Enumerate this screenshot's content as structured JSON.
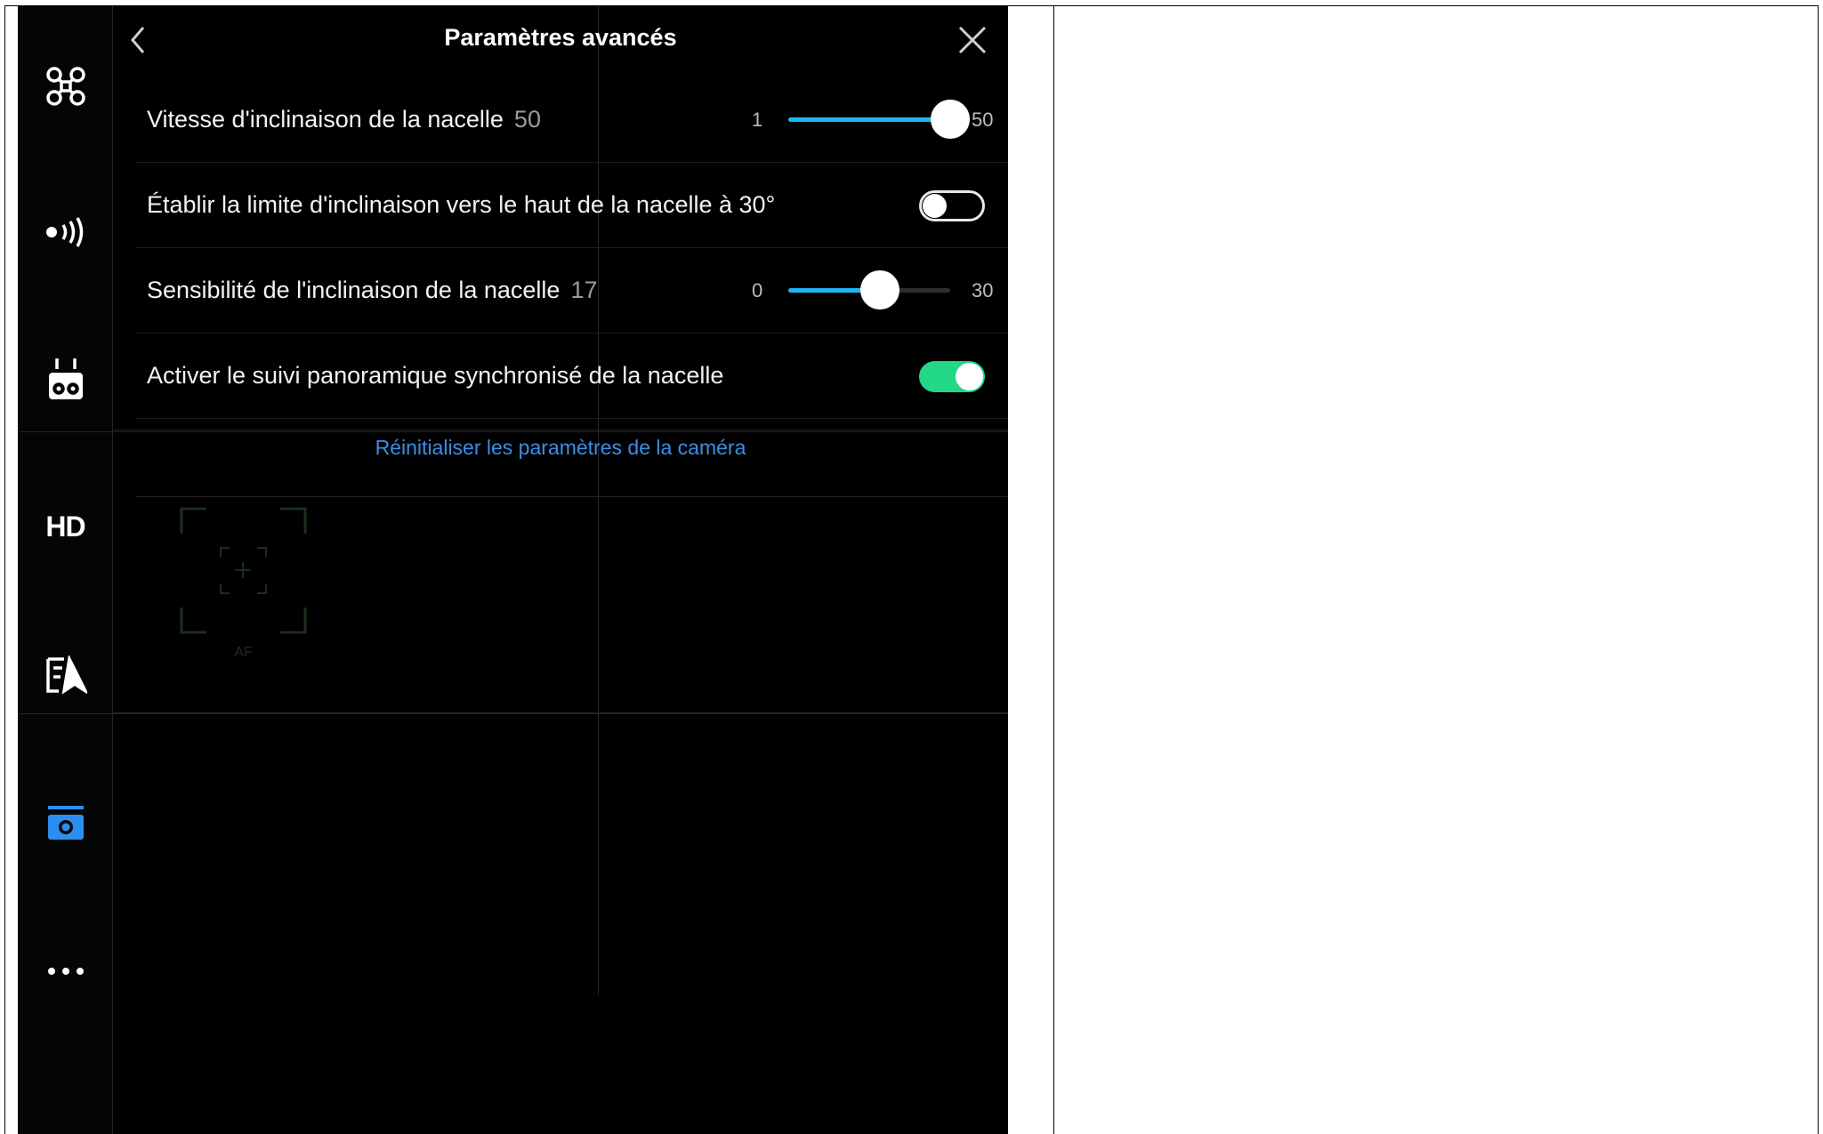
{
  "header": {
    "title": "Paramètres avancés"
  },
  "sidebar": {
    "items": [
      {
        "icon": "drone-icon"
      },
      {
        "icon": "signal-icon"
      },
      {
        "icon": "remote-controller-icon"
      },
      {
        "label": "HD",
        "icon": "hd-icon"
      },
      {
        "icon": "navigation-icon"
      },
      {
        "icon": "camera-icon",
        "active": true
      },
      {
        "icon": "more-icon"
      }
    ]
  },
  "settings": [
    {
      "label": "Vitesse d'inclinaison de la nacelle",
      "value": "50",
      "min": "1",
      "max": "50",
      "level": 1.0
    },
    {
      "label": "Établir la limite d'inclinaison vers le haut de la nacelle à 30°",
      "toggle": false
    },
    {
      "label": "Sensibilité de l'inclinaison de la nacelle",
      "value": "17",
      "min": "0",
      "max": "30",
      "level": 0.5667
    },
    {
      "label": "Activer le suivi panoramique synchronisé de la nacelle",
      "toggle": true
    }
  ],
  "reset_label": "Réinitialiser les paramètres de la caméra",
  "af_label": "AF",
  "colors": {
    "accent": "#1fb6f0",
    "toggle_on": "#22d887",
    "link": "#3b8ee6",
    "active_icon": "#2d8ef0"
  }
}
